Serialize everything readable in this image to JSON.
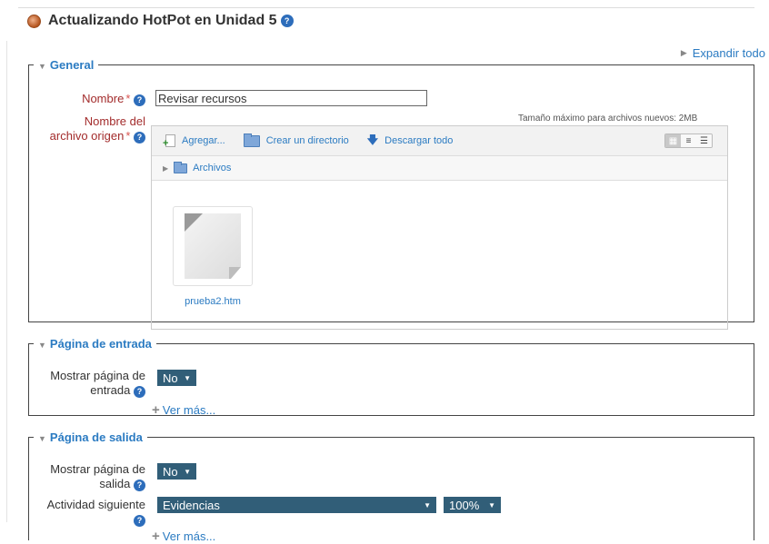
{
  "header": {
    "title": "Actualizando HotPot en Unidad 5",
    "expand_all": "Expandir todo"
  },
  "general": {
    "legend": "General",
    "name_label": "Nombre",
    "name_value": "Revisar recursos",
    "source_label_line1": "Nombre del",
    "source_label_line2": "archivo origen",
    "max_size": "Tamaño máximo para archivos nuevos: 2MB",
    "toolbar": {
      "add": "Agregar...",
      "mkdir": "Crear un directorio",
      "download": "Descargar todo"
    },
    "path": "Archivos",
    "file": {
      "name": "prueba2.htm"
    }
  },
  "entry": {
    "legend": "Página de entrada",
    "show_label_line1": "Mostrar página de",
    "show_label_line2": "entrada",
    "show_value": "No",
    "more": "Ver más..."
  },
  "exit": {
    "legend": "Página de salida",
    "show_label_line1": "Mostrar página de",
    "show_label_line2": "salida",
    "show_value": "No",
    "next_label": "Actividad siguiente",
    "next_value": "Evidencias",
    "grade_value": "100%",
    "more": "Ver más..."
  },
  "colors": {
    "link": "#2b7bc2",
    "select": "#315e78",
    "help": "#2d6dbb",
    "required": "#a32c2c"
  }
}
